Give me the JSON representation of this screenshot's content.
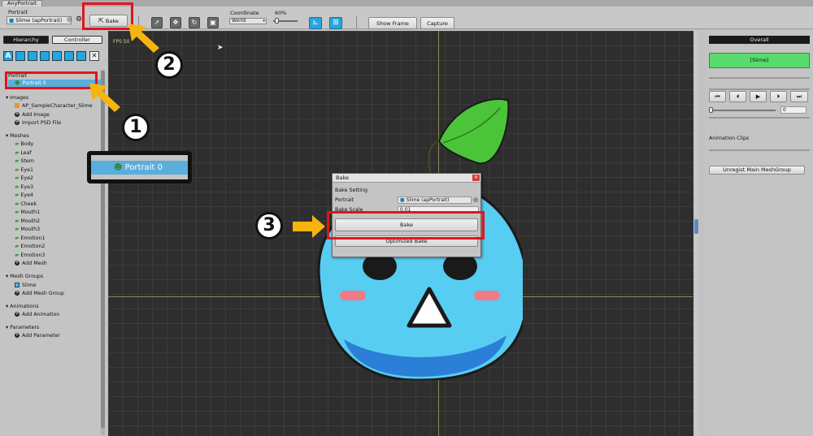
{
  "window": {
    "title": "AnyPortrait"
  },
  "toolbar": {
    "portrait_label": "Portrait",
    "portrait_value": "Slime (apPortrait)",
    "bake_label": "Bake",
    "coordinate_label": "Coordinate",
    "coordinate_value": "World",
    "zoom_value": "60%",
    "show_frame_label": "Show Frame",
    "capture_label": "Capture"
  },
  "left_panel": {
    "tabs": [
      "Hierarchy",
      "Controller"
    ],
    "portrait_section": "Portrait",
    "portrait_item": "Portrait 0",
    "images_section": "Images",
    "images": [
      "AP_SampleCharacter_Slime"
    ],
    "add_image": "Add Image",
    "import_psd": "Import PSD File",
    "meshes_section": "Meshes",
    "meshes": [
      "Body",
      "Leaf",
      "Stem",
      "Eye1",
      "Eye2",
      "Eye3",
      "Eye4",
      "Cheek",
      "Mouth1",
      "Mouth2",
      "Mouth3",
      "Emotion1",
      "Emotion2",
      "Emotion3"
    ],
    "add_mesh": "Add Mesh",
    "mesh_groups_section": "Mesh Groups",
    "mesh_groups": [
      "Slime"
    ],
    "add_mesh_group": "Add Mesh Group",
    "animations_section": "Animations",
    "add_animation": "Add Animation",
    "parameters_section": "Parameters",
    "add_parameter": "Add Parameter"
  },
  "zoom_callout": {
    "label": "Portrait 0"
  },
  "viewport": {
    "fps_label": "FPS 50"
  },
  "bake_dialog": {
    "title": "Bake",
    "setting_header": "Bake Setting",
    "portrait_label": "Portrait",
    "portrait_value": "Slime (apPortrait)",
    "scale_label": "Bake Scale",
    "scale_value": "0.01",
    "bake_button": "Bake",
    "optimized_bake_button": "Optimized Bake",
    "close_icon": "close-icon"
  },
  "right_panel": {
    "header": "Overall",
    "slime_button": "[Slime]",
    "frame_value": "0",
    "animation_clips_label": "Animation Clips",
    "unregist_button": "Unregist Main MeshGroup"
  },
  "annotations": {
    "step1": "1",
    "step2": "2",
    "step3": "3"
  },
  "colors": {
    "accent_blue": "#2aa4dc",
    "highlight_red": "#e2141b",
    "arrow_yellow": "#f6b40e",
    "slime_green": "#58db6c",
    "selected_row": "#5aaedc"
  }
}
